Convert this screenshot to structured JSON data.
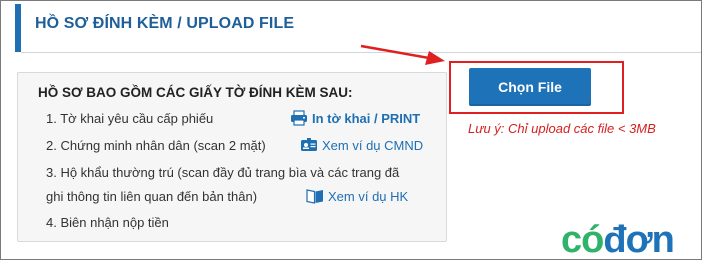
{
  "section": {
    "title": "HỒ SƠ ĐÍNH KÈM / UPLOAD FILE"
  },
  "documents": {
    "heading": "HỒ SƠ BAO GỒM CÁC GIẤY TỜ ĐÍNH KÈM SAU:",
    "items": [
      "1. Tờ khai yêu cầu cấp phiếu",
      "2. Chứng minh nhân dân (scan 2 mặt)",
      "3. Hộ khẩu thường trú (scan đầy đủ trang bìa và các trang đã",
      "ghi thông tin liên quan đến bản thân)",
      "4. Biên nhận nộp tiền"
    ],
    "links": {
      "print": "In tờ khai / PRINT",
      "cmnd": "Xem ví dụ CMND",
      "hk": "Xem ví dụ HK"
    }
  },
  "upload": {
    "button_label": "Chọn File",
    "note": "Lưu ý: Chỉ upload các file < 3MB"
  },
  "logo": {
    "text": "cóđơn"
  },
  "colors": {
    "accent_blue": "#1f6fb3",
    "title_blue": "#1f5f99",
    "highlight_red": "#e02020",
    "note_red": "#d62020",
    "logo_green": "#2fb36a",
    "logo_blue": "#1d72b8"
  },
  "icons": {
    "print": "printer-icon",
    "cmnd": "id-card-icon",
    "hk": "book-icon",
    "arrow": "red-arrow-icon"
  }
}
